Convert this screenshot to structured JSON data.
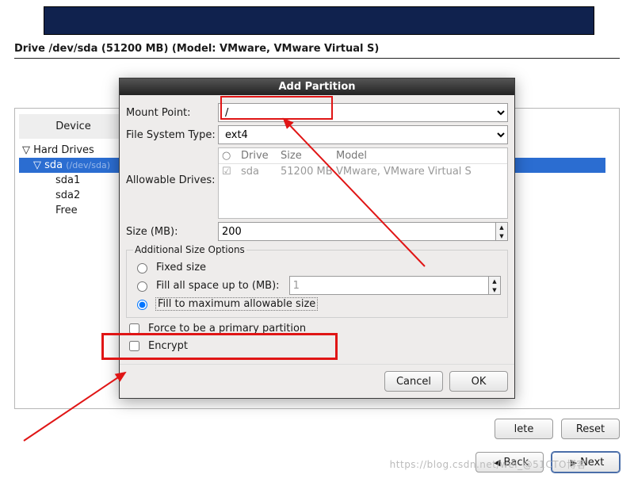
{
  "drive_header": "Drive /dev/sda (51200 MB) (Model: VMware, VMware Virtual S)",
  "device_col": "Device",
  "tree": {
    "hard_drives": "Hard Drives",
    "sda": "sda",
    "sda_path": "(/dev/sda)",
    "sda1": "sda1",
    "sda2": "sda2",
    "free": "Free"
  },
  "buttons": {
    "lete": "lete",
    "reset": "Reset",
    "back": "Back",
    "next": "Next",
    "cancel": "Cancel",
    "ok": "OK"
  },
  "dialog": {
    "title": "Add Partition",
    "mount_label": "Mount Point:",
    "mount_value": "/",
    "fs_label": "File System Type:",
    "fs_value": "ext4",
    "allow_label": "Allowable Drives:",
    "drives_cols": {
      "chk": "",
      "drive": "Drive",
      "size": "Size",
      "model": "Model"
    },
    "drives_row": {
      "name": "sda",
      "size": "51200 MB",
      "model": "VMware, VMware Virtual S"
    },
    "size_label": "Size (MB):",
    "size_value": "200",
    "aso_legend": "Additional Size Options",
    "opt_fixed": "Fixed size",
    "opt_fillupto": "Fill all space up to (MB):",
    "opt_fillupto_val": "1",
    "opt_fillmax": "Fill to maximum allowable size",
    "force_primary": "Force to be a primary partition",
    "encrypt": "Encrypt"
  },
  "watermark": "https://blog.csdn.net/wei_@51CTO博客"
}
